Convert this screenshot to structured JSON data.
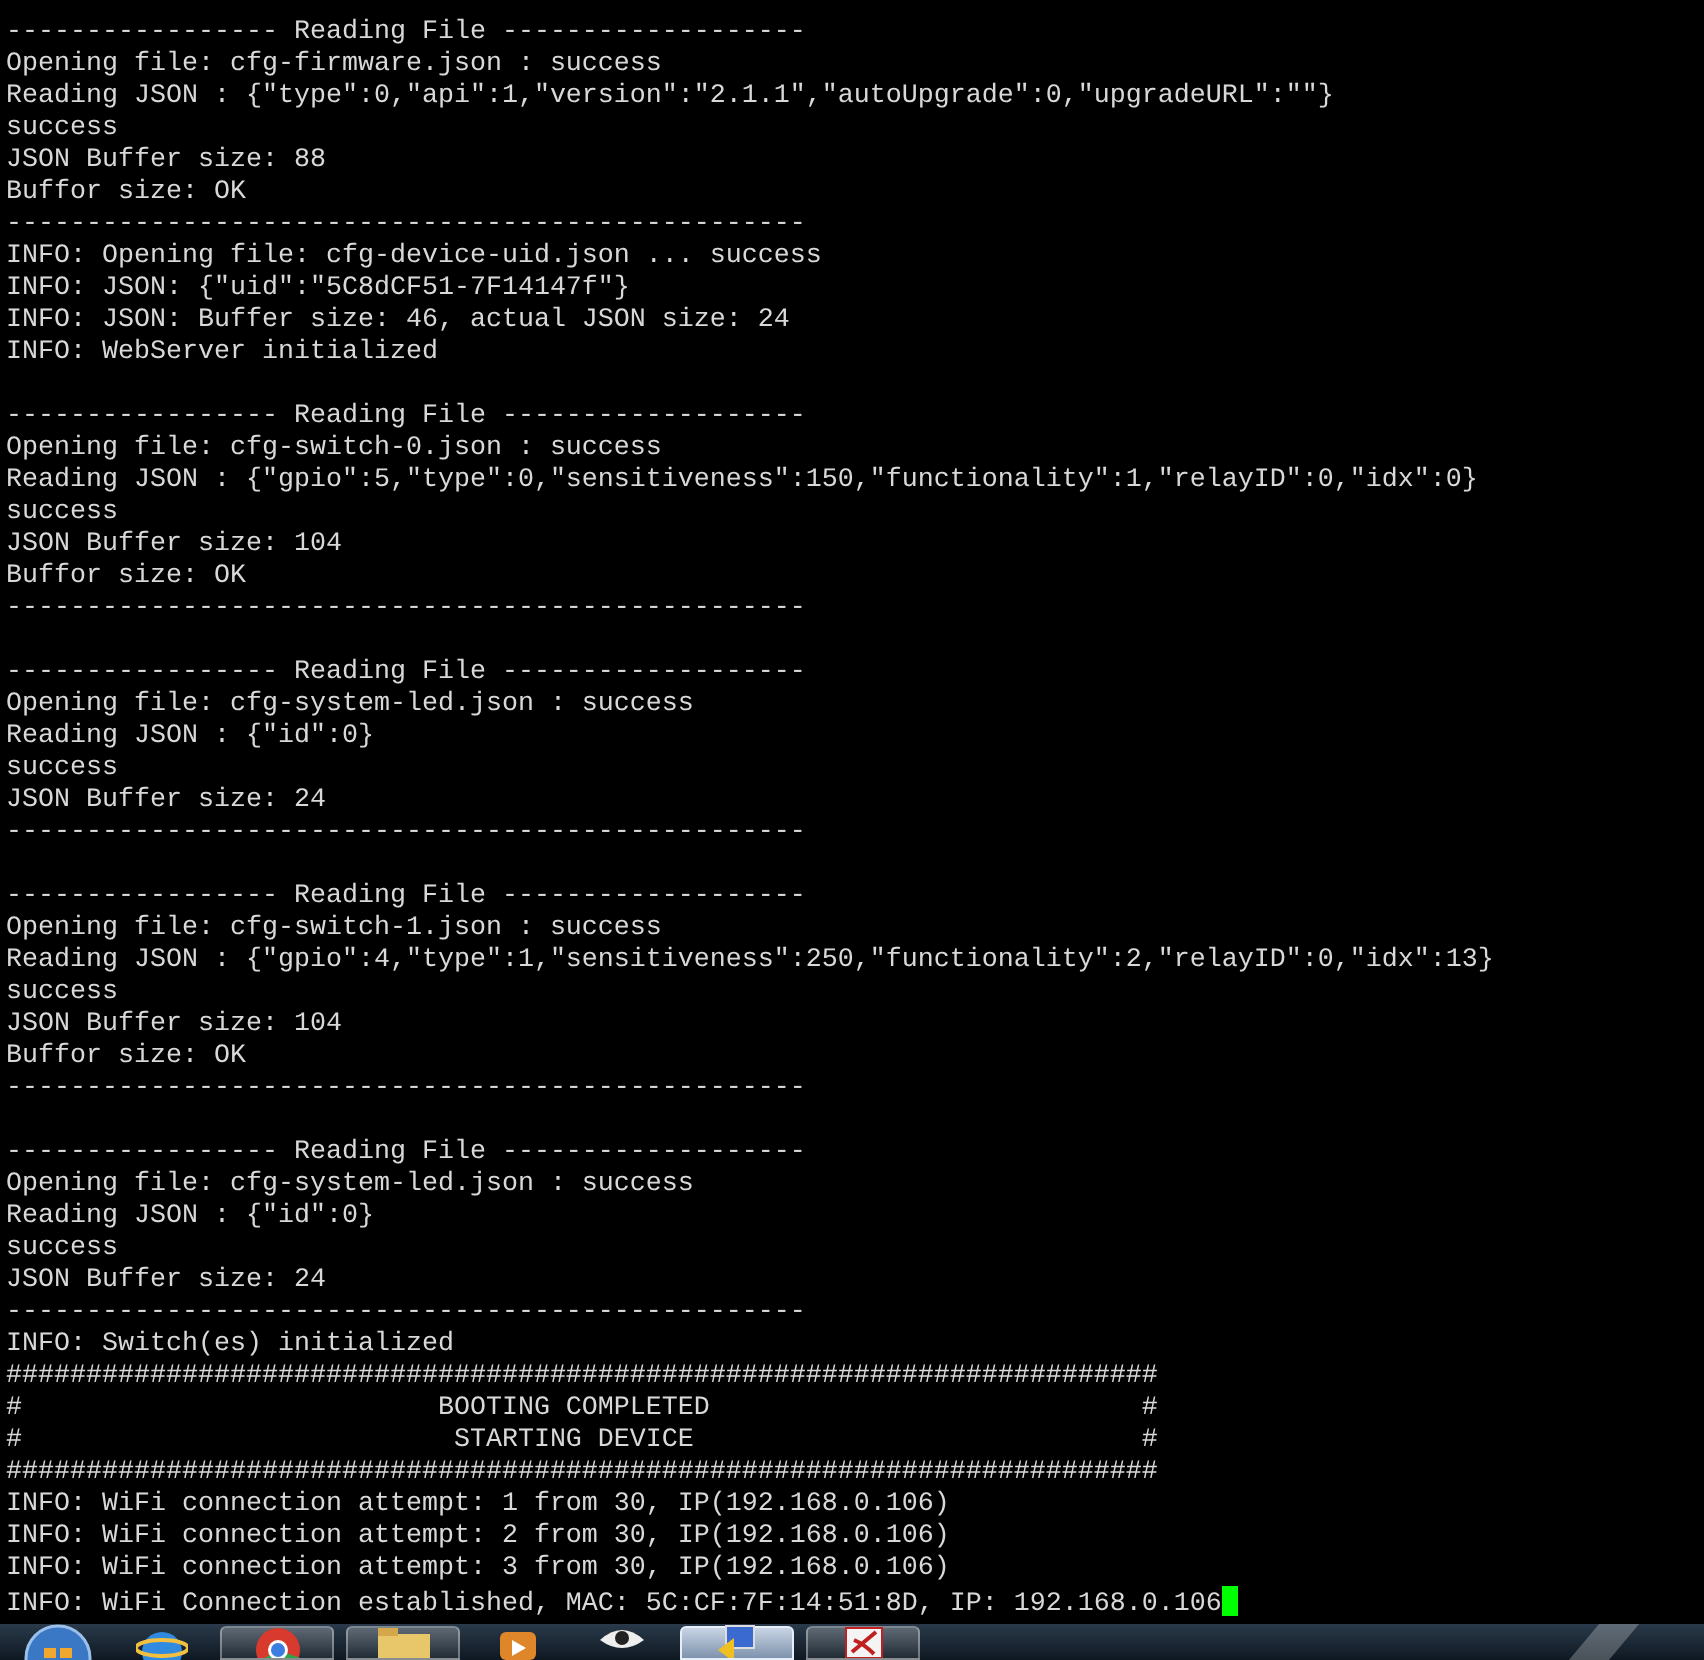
{
  "terminal": {
    "lines": [
      {
        "kind": "text",
        "text": "----------------- Reading File -------------------"
      },
      {
        "kind": "text",
        "text": "Opening file: cfg-firmware.json : success"
      },
      {
        "kind": "text",
        "text": "Reading JSON : {\"type\":0,\"api\":1,\"version\":\"2.1.1\",\"autoUpgrade\":0,\"upgradeURL\":\"\"}"
      },
      {
        "kind": "text",
        "text": "success"
      },
      {
        "kind": "text",
        "text": "JSON Buffer size: 88"
      },
      {
        "kind": "text",
        "text": "Buffor size: OK"
      },
      {
        "kind": "text",
        "text": "--------------------------------------------------"
      },
      {
        "kind": "text",
        "text": "INFO: Opening file: cfg-device-uid.json ... success"
      },
      {
        "kind": "text",
        "text": "INFO: JSON: {\"uid\":\"5C8dCF51-7F14147f\"}"
      },
      {
        "kind": "text",
        "text": "INFO: JSON: Buffer size: 46, actual JSON size: 24"
      },
      {
        "kind": "text",
        "text": "INFO: WebServer initialized"
      },
      {
        "kind": "blank"
      },
      {
        "kind": "text",
        "text": "----------------- Reading File -------------------"
      },
      {
        "kind": "text",
        "text": "Opening file: cfg-switch-0.json : success"
      },
      {
        "kind": "text",
        "text": "Reading JSON : {\"gpio\":5,\"type\":0,\"sensitiveness\":150,\"functionality\":1,\"relayID\":0,\"idx\":0}"
      },
      {
        "kind": "text",
        "text": "success"
      },
      {
        "kind": "text",
        "text": "JSON Buffer size: 104"
      },
      {
        "kind": "text",
        "text": "Buffor size: OK"
      },
      {
        "kind": "text",
        "text": "--------------------------------------------------"
      },
      {
        "kind": "blank"
      },
      {
        "kind": "text",
        "text": "----------------- Reading File -------------------"
      },
      {
        "kind": "text",
        "text": "Opening file: cfg-system-led.json : success"
      },
      {
        "kind": "text",
        "text": "Reading JSON : {\"id\":0}"
      },
      {
        "kind": "text",
        "text": "success"
      },
      {
        "kind": "text",
        "text": "JSON Buffer size: 24"
      },
      {
        "kind": "text",
        "text": "--------------------------------------------------"
      },
      {
        "kind": "blank"
      },
      {
        "kind": "text",
        "text": "----------------- Reading File -------------------"
      },
      {
        "kind": "text",
        "text": "Opening file: cfg-switch-1.json : success"
      },
      {
        "kind": "text",
        "text": "Reading JSON : {\"gpio\":4,\"type\":1,\"sensitiveness\":250,\"functionality\":2,\"relayID\":0,\"idx\":13}"
      },
      {
        "kind": "text",
        "text": "success"
      },
      {
        "kind": "text",
        "text": "JSON Buffer size: 104"
      },
      {
        "kind": "text",
        "text": "Buffor size: OK"
      },
      {
        "kind": "text",
        "text": "--------------------------------------------------"
      },
      {
        "kind": "blank"
      },
      {
        "kind": "text",
        "text": "----------------- Reading File -------------------"
      },
      {
        "kind": "text",
        "text": "Opening file: cfg-system-led.json : success"
      },
      {
        "kind": "text",
        "text": "Reading JSON : {\"id\":0}"
      },
      {
        "kind": "text",
        "text": "success"
      },
      {
        "kind": "text",
        "text": "JSON Buffer size: 24"
      },
      {
        "kind": "text",
        "text": "--------------------------------------------------"
      },
      {
        "kind": "text",
        "text": "INFO: Switch(es) initialized"
      },
      {
        "kind": "text",
        "text": "########################################################################"
      },
      {
        "kind": "text",
        "text": "#                          BOOTING COMPLETED                           #"
      },
      {
        "kind": "text",
        "text": "#                           STARTING DEVICE                            #"
      },
      {
        "kind": "text",
        "text": "########################################################################"
      },
      {
        "kind": "text",
        "text": "INFO: WiFi connection attempt: 1 from 30, IP(192.168.0.106)"
      },
      {
        "kind": "text",
        "text": "INFO: WiFi connection attempt: 2 from 30, IP(192.168.0.106)"
      },
      {
        "kind": "text",
        "text": "INFO: WiFi connection attempt: 3 from 30, IP(192.168.0.106)"
      },
      {
        "kind": "text",
        "text": "INFO: WiFi Connection established, MAC: 5C:CF:7F:14:51:8D, IP: 192.168.0.106",
        "cursor": true
      }
    ]
  },
  "taskbar": {
    "items": [
      {
        "kind": "start",
        "selected": false
      },
      {
        "kind": "globe",
        "selected": false
      },
      {
        "kind": "chrome",
        "selected": false
      },
      {
        "kind": "folder",
        "selected": false
      },
      {
        "kind": "media",
        "selected": false
      },
      {
        "kind": "eye",
        "selected": false
      },
      {
        "kind": "monitor",
        "selected": true
      },
      {
        "kind": "document",
        "selected": false
      }
    ]
  }
}
